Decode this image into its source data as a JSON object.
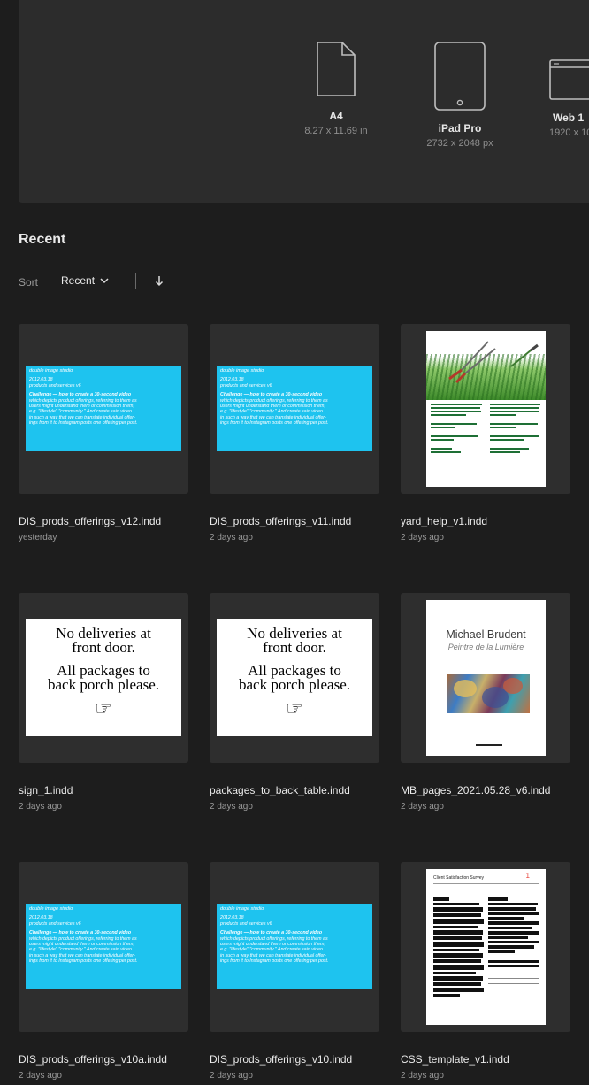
{
  "presets": [
    {
      "icon": "document-icon",
      "name": "A4",
      "size": "8.27 x 11.69 in"
    },
    {
      "icon": "tablet-icon",
      "name": "iPad Pro",
      "size": "2732 x 2048 px"
    },
    {
      "icon": "browser-window-icon",
      "name": "Web 1",
      "size": "1920 x 10"
    }
  ],
  "recent": {
    "title": "Recent",
    "sort_label": "Sort",
    "sort_value": "Recent"
  },
  "blue_preview": {
    "brand": "double image studio",
    "date": "2012.03.18",
    "subtitle": "products and services v6",
    "lines": [
      "Challenge — how to create a 30-second video",
      "which depicts product offerings, referring to them as",
      "users might understand them or commission them,",
      "e.g. \"lifestyle\" \"community.\" And create said video",
      "in such a way that we can translate individual offer-",
      "ings from it to Instagram posts one offering per post."
    ]
  },
  "sign_preview": {
    "line1": "No deliveries at",
    "line2": "front door.",
    "line3": "All packages to",
    "line4": "back porch please.",
    "glyph": "☞"
  },
  "mb_preview": {
    "title": "Michael Brudent",
    "subtitle": "Peintre de la Lumière"
  },
  "css_preview": {
    "title": "Client Satisfaction Survey",
    "number": "1"
  },
  "files": [
    {
      "name": "DIS_prods_offerings_v12.indd",
      "date": "yesterday",
      "preview": "blue"
    },
    {
      "name": "DIS_prods_offerings_v11.indd",
      "date": "2 days ago",
      "preview": "blue"
    },
    {
      "name": "yard_help_v1.indd",
      "date": "2 days ago",
      "preview": "yard"
    },
    {
      "name": "sign_1.indd",
      "date": "2 days ago",
      "preview": "sign"
    },
    {
      "name": "packages_to_back_table.indd",
      "date": "2 days ago",
      "preview": "sign"
    },
    {
      "name": "MB_pages_2021.05.28_v6.indd",
      "date": "2 days ago",
      "preview": "mb"
    },
    {
      "name": "DIS_prods_offerings_v10a.indd",
      "date": "2 days ago",
      "preview": "blue"
    },
    {
      "name": "DIS_prods_offerings_v10.indd",
      "date": "2 days ago",
      "preview": "blue"
    },
    {
      "name": "CSS_template_v1.indd",
      "date": "2 days ago",
      "preview": "css"
    }
  ],
  "colors": {
    "background": "#1d1d1d",
    "panel": "#2c2c2c",
    "card": "#2e2e2e",
    "preview_blue": "#1ec3ef"
  }
}
